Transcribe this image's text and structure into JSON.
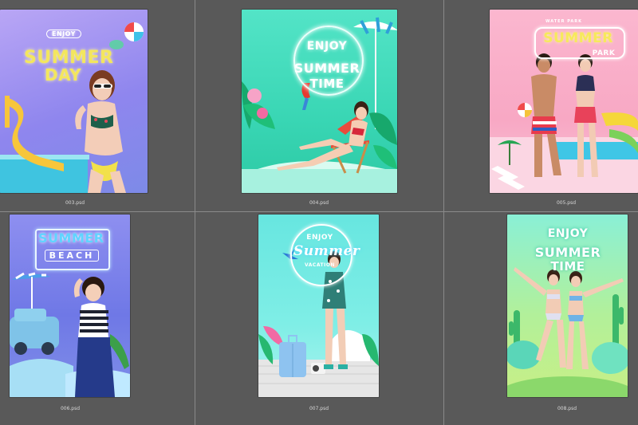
{
  "files": [
    {
      "filename": "003.psd",
      "headline_top": "ENJOY",
      "headline_main": "SUMMER",
      "headline_sub": "DAY"
    },
    {
      "filename": "004.psd",
      "headline_top": "ENJOY",
      "headline_main": "SUMMER",
      "headline_sub": "TIME"
    },
    {
      "filename": "005.psd",
      "headline_top": "WATER PARK",
      "headline_main": "SUMMER",
      "headline_sub": "PARK"
    },
    {
      "filename": "006.psd",
      "headline_top": "",
      "headline_main": "SUMMER",
      "headline_sub": "BEACH"
    },
    {
      "filename": "007.psd",
      "headline_top": "ENJOY",
      "headline_main": "Summer",
      "headline_sub": "VACATION"
    },
    {
      "filename": "008.psd",
      "headline_top": "ENJOY",
      "headline_main": "SUMMER",
      "headline_sub": "TIME"
    }
  ],
  "colors": {
    "panel_bg": "#5c5c5c",
    "divider": "#8a8a8a",
    "caption": "#d8d8d8"
  }
}
